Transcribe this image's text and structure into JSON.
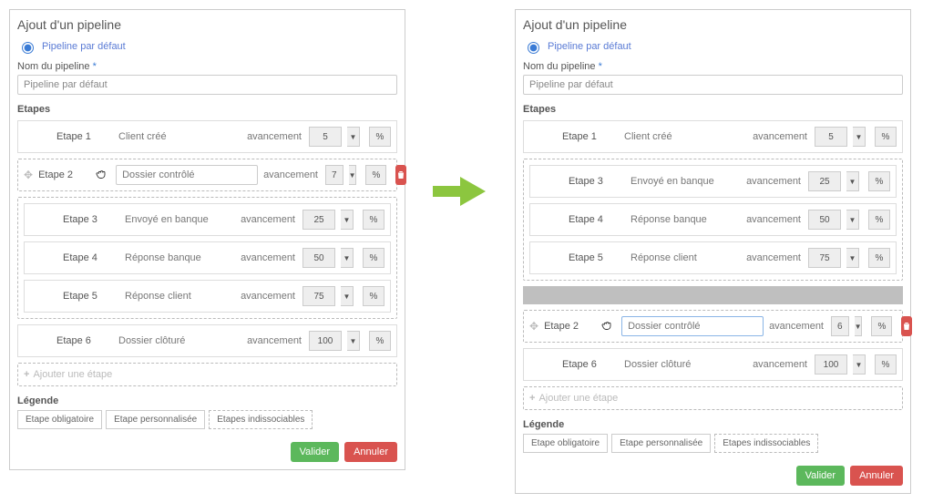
{
  "title": "Ajout d'un pipeline",
  "radio_label": "Pipeline par défaut",
  "name_field": {
    "label": "Nom du pipeline",
    "req": "*",
    "value": "Pipeline par défaut"
  },
  "steps_header": "Etapes",
  "av_label": "avancement",
  "percent": "%",
  "add_step": "Ajouter une étape",
  "legend": {
    "title": "Légende",
    "a": "Etape obligatoire",
    "b": "Etape personnalisée",
    "c": "Etapes indissociables"
  },
  "btn": {
    "ok": "Valider",
    "cancel": "Annuler"
  },
  "left": {
    "s1": {
      "label": "Etape 1",
      "name": "Client créé",
      "val": "5"
    },
    "s2": {
      "label": "Etape 2",
      "name": "Dossier contrôlé",
      "val": "7"
    },
    "s3": {
      "label": "Etape 3",
      "name": "Envoyé en banque",
      "val": "25"
    },
    "s4": {
      "label": "Etape 4",
      "name": "Réponse banque",
      "val": "50"
    },
    "s5": {
      "label": "Etape 5",
      "name": "Réponse client",
      "val": "75"
    },
    "s6": {
      "label": "Etape 6",
      "name": "Dossier clôturé",
      "val": "100"
    }
  },
  "right": {
    "s1": {
      "label": "Etape 1",
      "name": "Client créé",
      "val": "5"
    },
    "s3": {
      "label": "Etape 3",
      "name": "Envoyé en banque",
      "val": "25"
    },
    "s4": {
      "label": "Etape 4",
      "name": "Réponse banque",
      "val": "50"
    },
    "s5": {
      "label": "Etape 5",
      "name": "Réponse client",
      "val": "75"
    },
    "s2": {
      "label": "Etape 2",
      "name": "Dossier contrôlé",
      "val": "6"
    },
    "s6": {
      "label": "Etape 6",
      "name": "Dossier clôturé",
      "val": "100"
    }
  }
}
